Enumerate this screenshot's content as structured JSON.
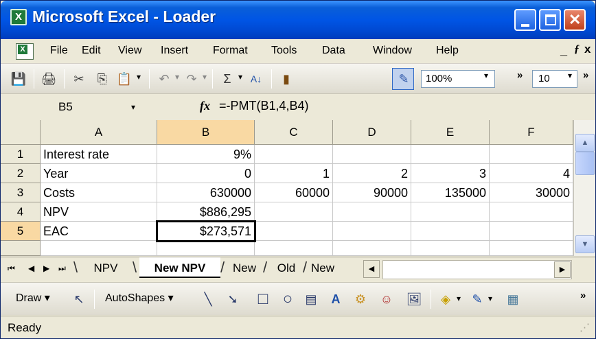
{
  "window": {
    "title": "Microsoft Excel - Loader",
    "app_icon_glyph": "X",
    "controls": {
      "minimize": "minimize-icon",
      "maximize": "maximize-icon",
      "close": "close-icon",
      "close_glyph": "✕"
    }
  },
  "menubar": {
    "items": [
      {
        "label": "File"
      },
      {
        "label": "Edit"
      },
      {
        "label": "View"
      },
      {
        "label": "Insert"
      },
      {
        "label": "Format"
      },
      {
        "label": "Tools"
      },
      {
        "label": "Data"
      },
      {
        "label": "Window"
      },
      {
        "label": "Help"
      }
    ],
    "doc_min": "_",
    "doc_restore": "ƒ",
    "doc_close": "x"
  },
  "toolbar": {
    "zoom": "100%",
    "font_size": "10",
    "overflow": "»",
    "icons": {
      "save": "💾",
      "print": "🖨",
      "cut": "✂",
      "copy": "⎘",
      "paste": "📋",
      "undo": "↶",
      "redo": "↷",
      "autosum": "Σ",
      "sort": "A↓",
      "chart": "▮",
      "drawing": "✎",
      "dropdown": "▾"
    }
  },
  "formula_bar": {
    "name_box": "B5",
    "fx": "fx",
    "formula": "=-PMT(B1,4,B4)"
  },
  "sheet": {
    "columns": [
      "A",
      "B",
      "C",
      "D",
      "E",
      "F"
    ],
    "rows": [
      {
        "num": "1",
        "cells": [
          "Interest rate",
          "9%",
          "",
          "",
          "",
          ""
        ]
      },
      {
        "num": "2",
        "cells": [
          "Year",
          "0",
          "1",
          "2",
          "3",
          "4"
        ]
      },
      {
        "num": "3",
        "cells": [
          "Costs",
          "630000",
          "60000",
          "90000",
          "135000",
          "30000"
        ]
      },
      {
        "num": "4",
        "cells": [
          "NPV",
          "$886,295",
          "",
          "",
          "",
          ""
        ]
      },
      {
        "num": "5",
        "cells": [
          "EAC",
          "$273,571",
          "",
          "",
          "",
          ""
        ]
      }
    ],
    "selected_cell": "B5"
  },
  "tabs": {
    "items": [
      {
        "label": "NPV",
        "active": false
      },
      {
        "label": "New NPV",
        "active": true
      },
      {
        "label": "New",
        "active": false
      },
      {
        "label": "Old",
        "active": false
      },
      {
        "label": "New",
        "active": false
      }
    ],
    "nav": [
      "⏮",
      "◀",
      "▶",
      "⏭"
    ]
  },
  "drawbar": {
    "draw": "Draw",
    "autoshapes": "AutoShapes",
    "dropdown": "▾",
    "icons": {
      "select": "↖",
      "line": "╲",
      "arrow": "➘",
      "rectangle": "□",
      "oval": "○",
      "textbox": "▤",
      "wordart": "A",
      "diagram": "⚙",
      "clipart": "☺",
      "picture": "🖼",
      "fill": "◈",
      "linecolor": "✎",
      "shadow3d": "▦"
    }
  },
  "status": {
    "text": "Ready"
  }
}
